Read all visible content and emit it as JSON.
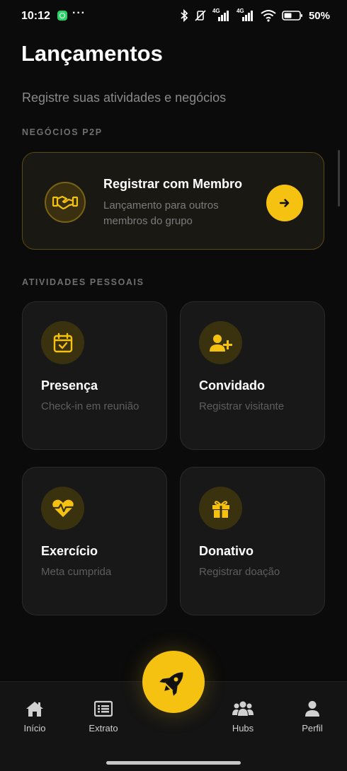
{
  "status_bar": {
    "time": "10:12",
    "battery_text": "50%",
    "network_1": "4G",
    "network_2": "4G"
  },
  "header": {
    "title": "Lançamentos",
    "subtitle": "Registre suas atividades e negócios"
  },
  "sections": {
    "p2p_label": "NEGÓCIOS P2P",
    "pessoais_label": "ATIVIDADES PESSOAIS"
  },
  "p2p_card": {
    "title": "Registrar com Membro",
    "description": "Lançamento para outros membros do grupo",
    "icon": "handshake-icon"
  },
  "activities": [
    {
      "title": "Presença",
      "description": "Check-in em reunião",
      "icon": "calendar-check-icon"
    },
    {
      "title": "Convidado",
      "description": "Registrar visitante",
      "icon": "user-plus-icon"
    },
    {
      "title": "Exercício",
      "description": "Meta cumprida",
      "icon": "heart-pulse-icon"
    },
    {
      "title": "Donativo",
      "description": "Registrar doação",
      "icon": "gift-icon"
    }
  ],
  "bottom_nav": {
    "items": [
      {
        "label": "Início",
        "icon": "home-icon"
      },
      {
        "label": "Extrato",
        "icon": "list-icon"
      },
      {
        "label": "Hubs",
        "icon": "users-icon"
      },
      {
        "label": "Perfil",
        "icon": "user-icon"
      }
    ],
    "fab_icon": "rocket-icon"
  },
  "colors": {
    "accent": "#f5c211",
    "background": "#0b0b0b",
    "card": "#181818"
  }
}
